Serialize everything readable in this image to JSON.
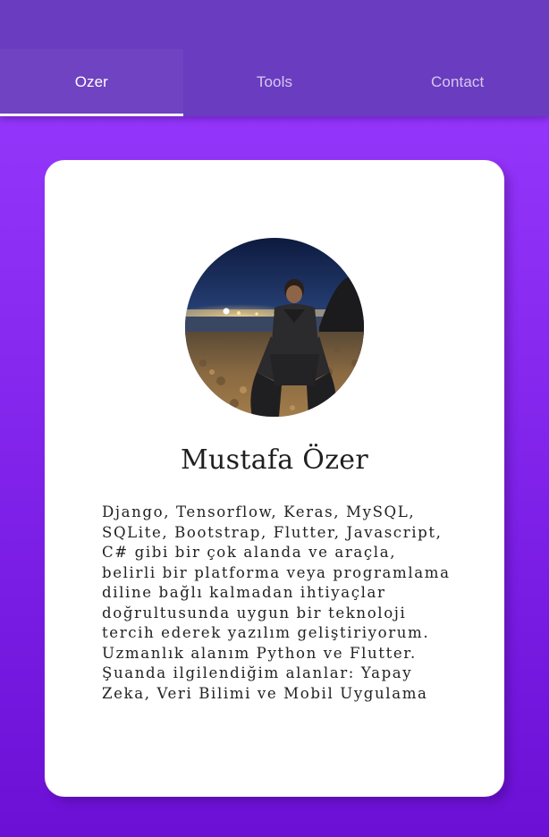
{
  "tabs": [
    {
      "label": "Ozer",
      "active": true
    },
    {
      "label": "Tools",
      "active": false
    },
    {
      "label": "Contact",
      "active": false
    }
  ],
  "profile": {
    "name": "Mustafa Özer",
    "bio": "Django, Tensorflow, Keras, MySQL, SQLite, Bootstrap, Flutter, Javascript, C# gibi bir çok alanda ve araçla, belirli bir platforma veya programlama diline bağlı kalmadan ihtiyaçlar doğrultusunda uygun bir teknoloji tercih ederek yazılım geliştiriyorum. Uzmanlık alanım Python ve Flutter. Şuanda ilgilendiğim alanlar: Yapay Zeka, Veri Bilimi ve Mobil Uygulama"
  },
  "colors": {
    "appbar": "#6a3cc0",
    "background_top": "#9a3bff",
    "background_bottom": "#6c10d6",
    "card": "#ffffff",
    "tab_active_text": "#ffffff",
    "tab_inactive_text": "#cdb8f2"
  }
}
